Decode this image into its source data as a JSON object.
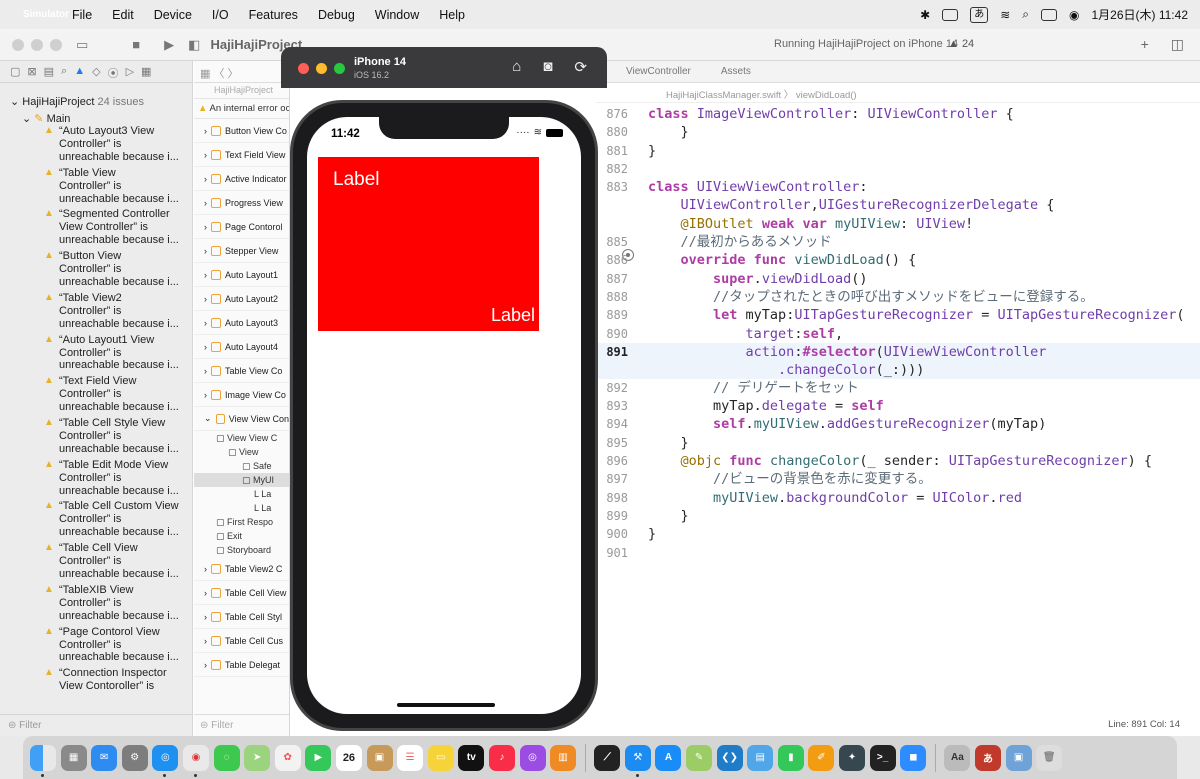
{
  "menubar": {
    "app": "Simulator",
    "items": [
      "File",
      "Edit",
      "Device",
      "I/O",
      "Features",
      "Debug",
      "Window",
      "Help"
    ],
    "ime": "あ",
    "date_time": "1月26日(木)  11:42"
  },
  "xcode": {
    "project": "HajiHajiProject",
    "run_status": "Running HajiHajiProject on iPhone 14",
    "warnings": "▲ 24"
  },
  "navigator": {
    "root_label": "HajiHajiProject",
    "root_count": "24 issues",
    "group": "Main",
    "issues": [
      "“Auto Layout3 View\nController” is\nunreachable because i...",
      "“Table View\nController” is\nunreachable because i...",
      "“Segmented Controller\nView Controller” is\nunreachable because i...",
      "“Button View\nController” is\nunreachable because i...",
      "“Table View2\nController” is\nunreachable because i...",
      "“Auto Layout1 View\nController” is\nunreachable because i...",
      "“Text Field View\nController” is\nunreachable because i...",
      "“Table Cell Style View\nController” is\nunreachable because i...",
      "“Table Edit Mode View\nController” is\nunreachable because i...",
      "“Table Cell Custom View\nController” is\nunreachable because i...",
      "“Table Cell View\nController” is\nunreachable because i...",
      "“TableXIB View\nController” is\nunreachable because i...",
      "“Page Contorol View\nController” is\nunreachable because i...",
      "“Connection Inspector\nView Contoroller” is"
    ],
    "filter": "Filter"
  },
  "outline": {
    "crumb": "HajiHajiProject",
    "warning": "An internal error occurred",
    "scenes_top": [
      "Button View Co",
      "Text Field View",
      "Active Indicator",
      "Progress View",
      "Page Contorol",
      "Stepper View",
      "Auto Layout1",
      "Auto Layout2",
      "Auto Layout3",
      "Auto Layout4",
      "Table View Co",
      "Image View Co",
      "View View Con"
    ],
    "tree": [
      "View View C",
      "View",
      "Safe",
      "MyUI",
      "La",
      "La",
      "First Respo",
      "Exit",
      "Storyboard"
    ],
    "scenes_bottom": [
      "Table View2 C",
      "Table Cell View",
      "Table Cell Styl",
      "Table Cell Cus",
      "Table Delegat"
    ],
    "filter": "Filter"
  },
  "editor": {
    "tabs": [
      "ViewController",
      "Assets"
    ],
    "crumb": "HajiHajiClassManager.swift  〉 viewDidLoad()",
    "status": "Line: 891  Col: 14"
  },
  "simulator": {
    "device": "iPhone 14",
    "os": "iOS 16.2",
    "time": "11:42",
    "label_top": "Label",
    "label_bottom": "Label"
  },
  "dock": {
    "calendar_day": "26",
    "apps": [
      "Finder",
      "Launchpad",
      "Mail",
      "System Settings",
      "Safari",
      "Chrome",
      "Messages",
      "Maps",
      "Photos",
      "FaceTime",
      "Calendar",
      "Notes",
      "Reminders",
      "Notes App",
      "TV",
      "Music",
      "Podcasts",
      "Books",
      "Stocks",
      "Xcode",
      "App Store",
      "Keynote",
      "VS Code",
      "Preview",
      "Numbers",
      "Pages",
      "Instruments",
      "Terminal",
      "Zoom",
      "Dictionary",
      "Kotoeri",
      "Photos2",
      "Trash"
    ],
    "colors": {
      "accent": "#1e7cf2",
      "red": "#ff0000"
    }
  }
}
